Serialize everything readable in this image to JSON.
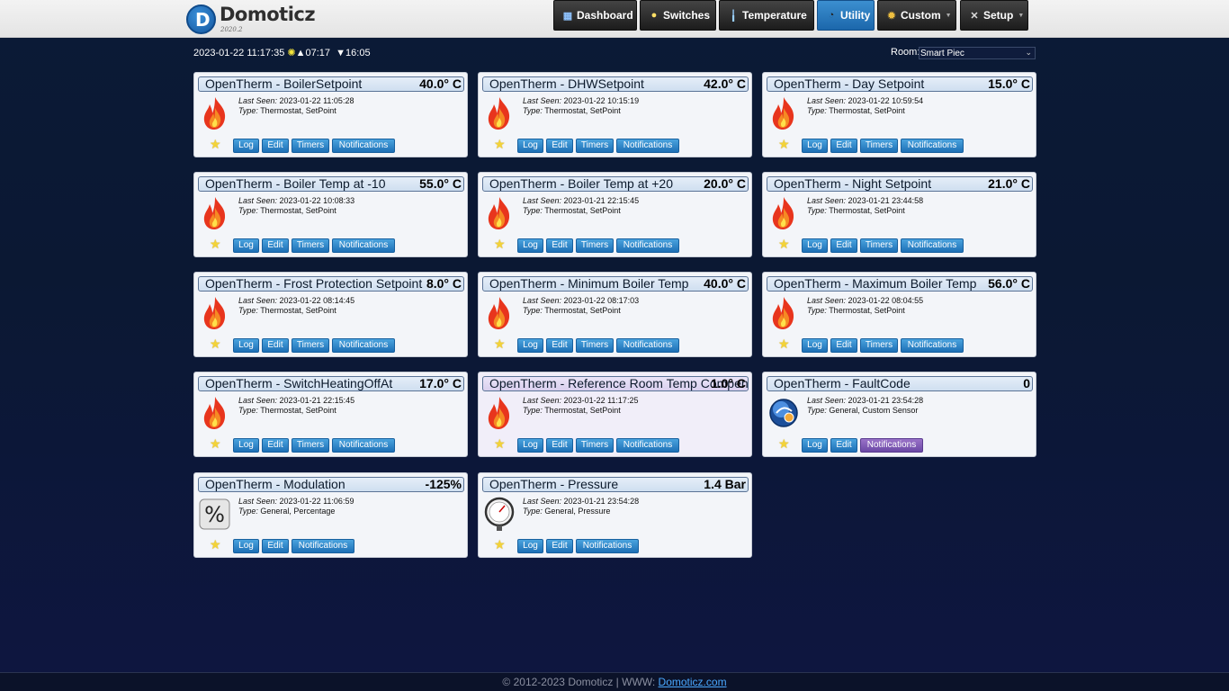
{
  "app": {
    "name": "Domoticz",
    "version": "2020.2"
  },
  "nav": [
    {
      "label": "Dashboard",
      "icon": "dashboard-icon"
    },
    {
      "label": "Switches",
      "icon": "bulb-icon"
    },
    {
      "label": "Temperature",
      "icon": "thermometer-icon"
    },
    {
      "label": "Utility",
      "icon": "utility-icon"
    },
    {
      "label": "Custom",
      "icon": "gear-icon"
    },
    {
      "label": "Setup",
      "icon": "tools-icon"
    }
  ],
  "infobar": {
    "datetime": "2023-01-22 11:17:35",
    "sunrise": "07:17",
    "sunset": "16:05"
  },
  "room": {
    "label": "Room:",
    "selected": "Smart Piec"
  },
  "devices": [
    {
      "title": "OpenTherm - BoilerSetpoint",
      "value": "40.0° C",
      "last_seen": "2023-01-22 11:05:28",
      "type": "Thermostat, SetPoint",
      "icon": "flame-icon",
      "buttons": [
        "Log",
        "Edit",
        "Timers",
        "Notifications"
      ]
    },
    {
      "title": "OpenTherm - DHWSetpoint",
      "value": "42.0° C",
      "last_seen": "2023-01-22 10:15:19",
      "type": "Thermostat, SetPoint",
      "icon": "flame-icon",
      "buttons": [
        "Log",
        "Edit",
        "Timers",
        "Notifications"
      ]
    },
    {
      "title": "OpenTherm - Day Setpoint",
      "value": "15.0° C",
      "last_seen": "2023-01-22 10:59:54",
      "type": "Thermostat, SetPoint",
      "icon": "flame-icon",
      "buttons": [
        "Log",
        "Edit",
        "Timers",
        "Notifications"
      ]
    },
    {
      "title": "OpenTherm - Boiler Temp at -10",
      "value": "55.0° C",
      "last_seen": "2023-01-22 10:08:33",
      "type": "Thermostat, SetPoint",
      "icon": "flame-icon",
      "buttons": [
        "Log",
        "Edit",
        "Timers",
        "Notifications"
      ]
    },
    {
      "title": "OpenTherm - Boiler Temp at +20",
      "value": "20.0° C",
      "last_seen": "2023-01-21 22:15:45",
      "type": "Thermostat, SetPoint",
      "icon": "flame-icon",
      "buttons": [
        "Log",
        "Edit",
        "Timers",
        "Notifications"
      ]
    },
    {
      "title": "OpenTherm - Night Setpoint",
      "value": "21.0° C",
      "last_seen": "2023-01-21 23:44:58",
      "type": "Thermostat, SetPoint",
      "icon": "flame-icon",
      "buttons": [
        "Log",
        "Edit",
        "Timers",
        "Notifications"
      ]
    },
    {
      "title": "OpenTherm - Frost Protection Setpoint",
      "value": "8.0° C",
      "last_seen": "2023-01-22 08:14:45",
      "type": "Thermostat, SetPoint",
      "icon": "flame-icon",
      "buttons": [
        "Log",
        "Edit",
        "Timers",
        "Notifications"
      ]
    },
    {
      "title": "OpenTherm - Minimum Boiler Temp",
      "value": "40.0° C",
      "last_seen": "2023-01-22 08:17:03",
      "type": "Thermostat, SetPoint",
      "icon": "flame-icon",
      "buttons": [
        "Log",
        "Edit",
        "Timers",
        "Notifications"
      ]
    },
    {
      "title": "OpenTherm - Maximum Boiler Temp",
      "value": "56.0° C",
      "last_seen": "2023-01-22 08:04:55",
      "type": "Thermostat, SetPoint",
      "icon": "flame-icon",
      "buttons": [
        "Log",
        "Edit",
        "Timers",
        "Notifications"
      ]
    },
    {
      "title": "OpenTherm - SwitchHeatingOffAt",
      "value": "17.0° C",
      "last_seen": "2023-01-21 22:15:45",
      "type": "Thermostat, SetPoint",
      "icon": "flame-icon",
      "buttons": [
        "Log",
        "Edit",
        "Timers",
        "Notifications"
      ]
    },
    {
      "title": "OpenTherm - Reference Room Temp Compens",
      "value": "1.0° C",
      "last_seen": "2023-01-22 11:17:25",
      "type": "Thermostat, SetPoint",
      "icon": "flame-icon",
      "buttons": [
        "Log",
        "Edit",
        "Timers",
        "Notifications"
      ],
      "highlight": true
    },
    {
      "title": "OpenTherm - FaultCode",
      "value": "0",
      "last_seen": "2023-01-21 23:54:28",
      "type": "General, Custom Sensor",
      "icon": "custom-sensor-icon",
      "buttons": [
        "Log",
        "Edit",
        "Notifications"
      ],
      "notif_purple": true
    },
    {
      "title": "OpenTherm - Modulation",
      "value": "-125%",
      "last_seen": "2023-01-22 11:06:59",
      "type": "General, Percentage",
      "icon": "percent-icon",
      "buttons": [
        "Log",
        "Edit",
        "Notifications"
      ]
    },
    {
      "title": "OpenTherm - Pressure",
      "value": "1.4 Bar",
      "last_seen": "2023-01-21 23:54:28",
      "type": "General, Pressure",
      "icon": "gauge-icon",
      "buttons": [
        "Log",
        "Edit",
        "Notifications"
      ]
    }
  ],
  "labels": {
    "last_seen": "Last Seen:",
    "type": "Type:"
  },
  "footer": {
    "text": "© 2012-2023 Domoticz | WWW: ",
    "link": "Domoticz.com"
  },
  "colors": {
    "accent": "#1d70b6",
    "header_bg": "#e9e9e9",
    "page_bg": "#0b1a36",
    "notif_purple": "#6b48a5"
  }
}
